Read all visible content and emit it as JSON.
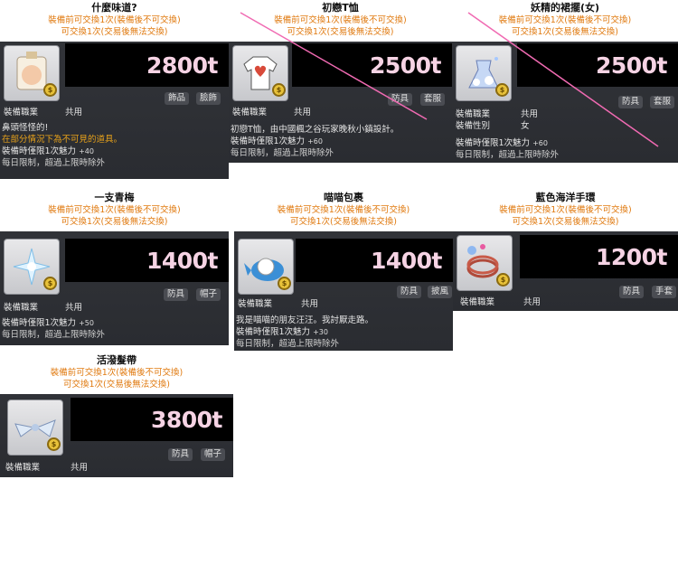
{
  "labels": {
    "tradeable_once": "裝備前可交換1次(裝備後不可交換)",
    "exchange_once": "可交換1次(交易後無法交換)",
    "job": "裝備職業",
    "job_value": "共用",
    "gender": "裝備性別",
    "gender_value": "女",
    "daily": "每日限制，超過上限時除外"
  },
  "items": [
    {
      "name": "什麼味道?",
      "price": "2800t",
      "tags": [
        "飾品",
        "臉飾"
      ],
      "desc1": "鼻頭怪怪的!",
      "desc2": "在部分情況下為不可見的道具。",
      "charm": "裝備時僅限1次魅力",
      "charm_bonus": "+40",
      "icon": "perfume-bottle-icon"
    },
    {
      "name": "初戀T恤",
      "price": "2500t",
      "tags": [
        "防具",
        "套服"
      ],
      "desc1": "初戀T恤，由中國楓之谷玩家晚秋小鎮設計。",
      "charm": "裝備時僅限1次魅力",
      "charm_bonus": "+60",
      "icon": "heart-tshirt-icon"
    },
    {
      "name": "妖精的裙擺(女)",
      "price": "2500t",
      "tags": [
        "防具",
        "套服"
      ],
      "charm": "裝備時僅限1次魅力",
      "charm_bonus": "+60",
      "icon": "fairy-dress-icon"
    },
    {
      "name": "一支青梅",
      "price": "1400t",
      "tags": [
        "防具",
        "帽子"
      ],
      "charm": "裝備時僅限1次魅力",
      "charm_bonus": "+50",
      "icon": "plum-blossom-icon"
    },
    {
      "name": "喵喵包裹",
      "price": "1400t",
      "tags": [
        "防具",
        "披風"
      ],
      "desc1": "我是喵喵的朋友汪汪。我討厭走路。",
      "charm": "裝備時僅限1次魅力",
      "charm_bonus": "+30",
      "icon": "cat-bundle-icon"
    },
    {
      "name": "藍色海洋手環",
      "price": "1200t",
      "tags": [
        "防具",
        "手套"
      ],
      "icon": "ocean-bracelet-icon"
    },
    {
      "name": "活潑髮帶",
      "price": "3800t",
      "tags": [
        "防具",
        "帽子"
      ],
      "icon": "hair-ribbon-icon"
    }
  ],
  "colors": {
    "price_text": "#f6d3e4",
    "orange_text": "#e07a10",
    "strike_line": "#f06ab2",
    "panel_bg": "#2f3136"
  }
}
